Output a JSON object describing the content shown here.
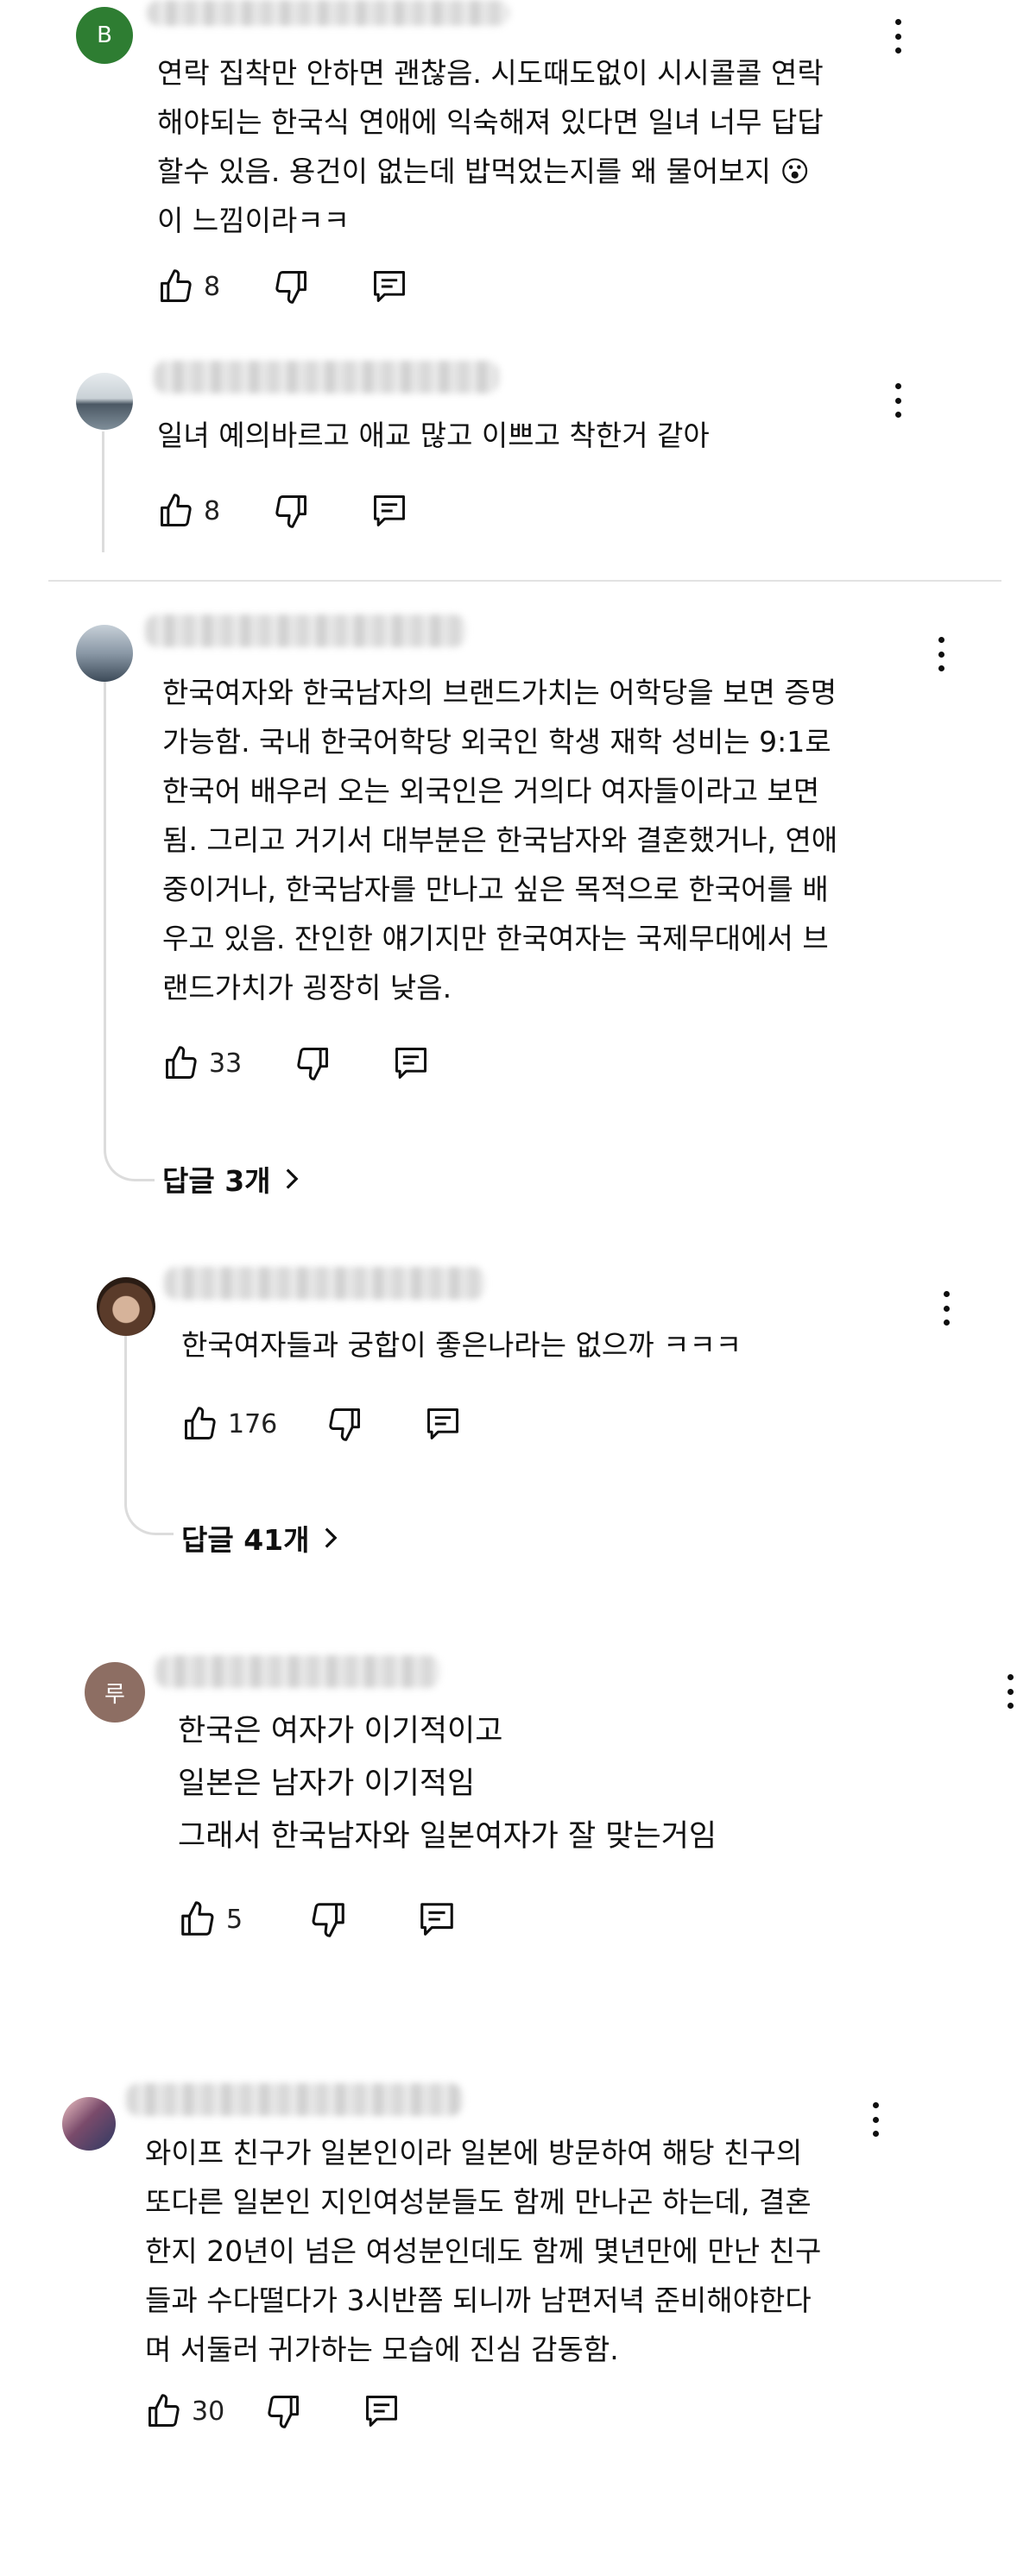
{
  "comments": [
    {
      "avatar_letter": "B",
      "avatar_color": "#2e7d32",
      "text": "연락 집착만 안하면 괜찮음. 시도때도없이 시시콜콜 연락\n해야되는 한국식 연애에 익숙해져 있다면 일녀 너무 답답\n할수 있음. 용건이 없는데 밥먹었는지를 왜 물어보지 😮\n이 느낌이라ㅋㅋ",
      "likes": "8"
    },
    {
      "text": "일녀 예의바르고 애교 많고 이쁘고 착한거 같아",
      "likes": "8"
    },
    {
      "text": "한국여자와 한국남자의 브랜드가치는 어학당을 보면 증명\n가능함. 국내 한국어학당 외국인 학생 재학 성비는 9:1로\n한국어 배우러 오는 외국인은 거의다 여자들이라고 보면\n됨. 그리고 거기서 대부분은 한국남자와 결혼했거나, 연애\n중이거나, 한국남자를 만나고 싶은 목적으로 한국어를 배\n우고 있음. 잔인한 얘기지만 한국여자는 국제무대에서 브\n랜드가치가 굉장히 낮음.",
      "likes": "33",
      "replies_label": "답글 3개"
    },
    {
      "text": "한국여자들과 궁합이 좋은나라는 없으까 ㅋㅋㅋ",
      "likes": "176",
      "replies_label": "답글 41개"
    },
    {
      "avatar_letter": "루",
      "avatar_color": "#8d6e63",
      "text": "한국은 여자가 이기적이고\n일본은 남자가 이기적임\n그래서 한국남자와 일본여자가 잘 맞는거임",
      "likes": "5"
    },
    {
      "text": "와이프 친구가 일본인이라 일본에 방문하여 해당 친구의\n또다른 일본인 지인여성분들도 함께 만나곤 하는데, 결혼\n한지 20년이 넘은 여성분인데도 함께 몇년만에 만난 친구\n들과 수다떨다가 3시반쯤 되니까 남편저녁 준비해야한다\n며 서둘러 귀가하는 모습에 진심 감동함.",
      "likes": "30"
    }
  ]
}
